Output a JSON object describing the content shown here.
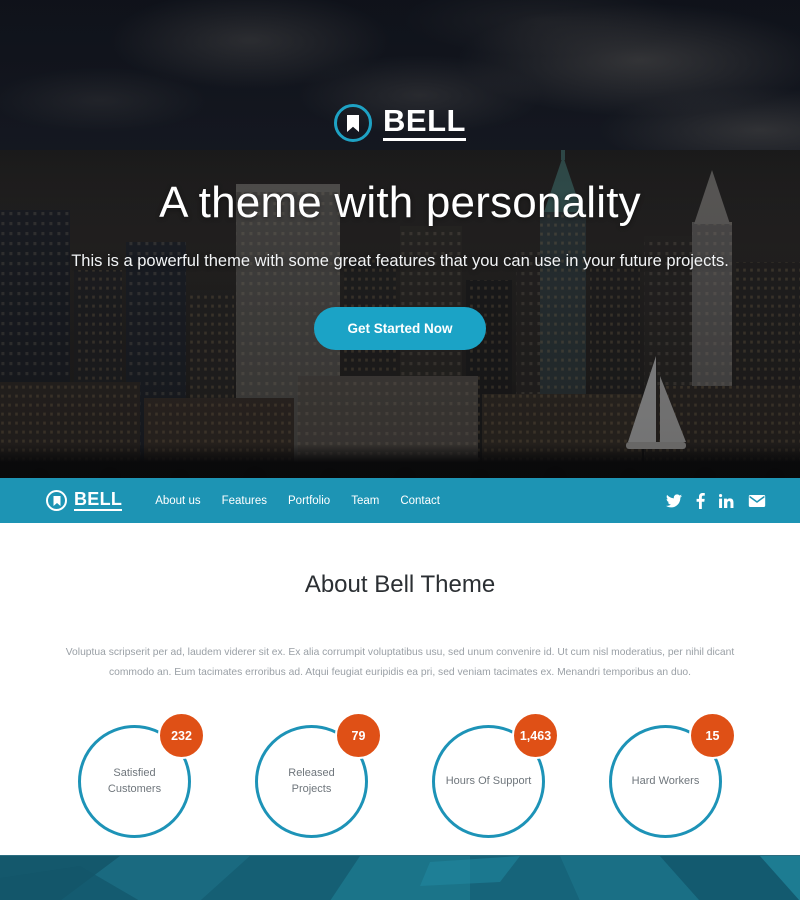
{
  "brand": {
    "name": "BELL",
    "logo_icon": "bookmark-icon",
    "accent_teal": "#1ba3c6",
    "nav_teal": "#1d94b4",
    "accent_orange": "#df5016",
    "footer_teal": "#186277"
  },
  "hero": {
    "title": "A theme with personality",
    "subtitle": "This is a powerful theme with some great features that you can use in your future projects.",
    "cta_label": "Get Started Now",
    "background": "night-city-skyline-photo"
  },
  "navbar": {
    "logo_label": "BELL",
    "links": [
      {
        "label": "About us"
      },
      {
        "label": "Features"
      },
      {
        "label": "Portfolio"
      },
      {
        "label": "Team"
      },
      {
        "label": "Contact"
      }
    ],
    "social": [
      {
        "icon": "twitter-icon",
        "name": "Twitter"
      },
      {
        "icon": "facebook-icon",
        "name": "Facebook"
      },
      {
        "icon": "linkedin-icon",
        "name": "LinkedIn"
      },
      {
        "icon": "email-icon",
        "name": "Email"
      }
    ]
  },
  "about": {
    "title": "About Bell Theme",
    "paragraph": "Voluptua scripserit per ad, laudem viderer sit ex. Ex alia corrumpit voluptatibus usu, sed unum convenire id. Ut cum nisl moderatius, per nihil dicant commodo an. Eum tacimates erroribus ad. Atqui feugiat euripidis ea pri, sed veniam tacimates ex. Menandri temporibus an duo.",
    "counters": [
      {
        "value": "232",
        "label": "Satisfied Customers"
      },
      {
        "value": "79",
        "label": "Released Projects"
      },
      {
        "value": "1,463",
        "label": "Hours Of Support"
      },
      {
        "value": "15",
        "label": "Hard Workers"
      }
    ]
  }
}
